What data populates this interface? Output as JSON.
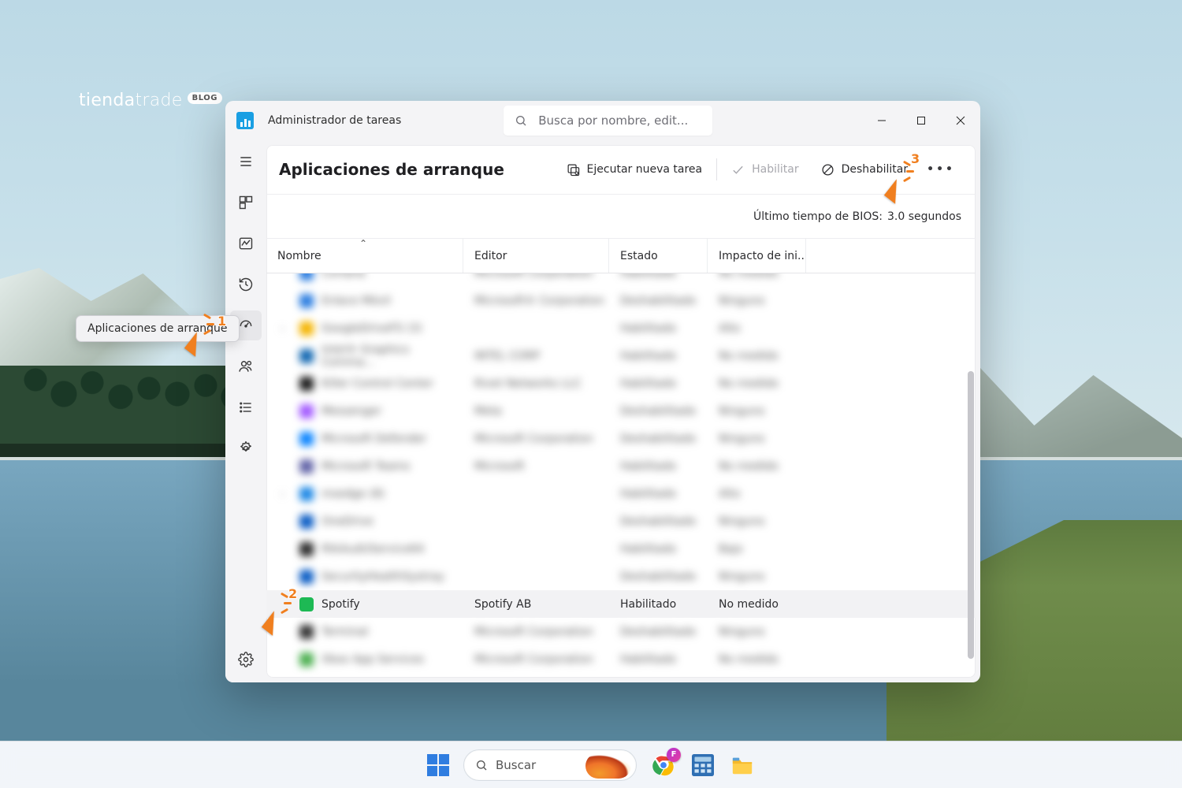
{
  "brand": {
    "part1": "tienda",
    "part2": "trade",
    "pill": "BLOG"
  },
  "taskbar": {
    "search_placeholder": "Buscar",
    "chrome_badge": "F"
  },
  "window": {
    "title": "Administrador de tareas",
    "search_placeholder": "Busca por nombre, edit..."
  },
  "sidebar": {
    "tooltip": "Aplicaciones de arranque",
    "items": [
      {
        "id": "hamburger"
      },
      {
        "id": "processes"
      },
      {
        "id": "performance"
      },
      {
        "id": "history"
      },
      {
        "id": "startup",
        "active": true
      },
      {
        "id": "users"
      },
      {
        "id": "details"
      },
      {
        "id": "services"
      }
    ],
    "bottom": {
      "id": "settings"
    }
  },
  "toolbar": {
    "page_title": "Aplicaciones de arranque",
    "run_new_task": "Ejecutar nueva tarea",
    "enable": "Habilitar",
    "disable": "Deshabilitar"
  },
  "bios": {
    "label": "Último tiempo de BIOS:",
    "value": "3.0 segundos"
  },
  "columns": {
    "name": "Nombre",
    "editor": "Editor",
    "state": "Estado",
    "impact": "Impacto de ini..."
  },
  "rows": [
    {
      "blurred": true,
      "expand": false,
      "icon": "#2b7de0",
      "name": "Cortana",
      "editor": "Microsoft Corporation",
      "state": "Habilitado",
      "impact": "No medido"
    },
    {
      "blurred": true,
      "expand": false,
      "icon": "#2b7de0",
      "name": "Enlace Móvil",
      "editor": "Microsoft® Corporation",
      "state": "Deshabilitado",
      "impact": "Ninguno"
    },
    {
      "blurred": true,
      "expand": true,
      "icon": "#f4b400",
      "name": "GoogleDriveFS (3)",
      "editor": "",
      "state": "Habilitado",
      "impact": "Alto"
    },
    {
      "blurred": true,
      "expand": false,
      "icon": "#1167b1",
      "name": "Intel® Graphics Comma...",
      "editor": "INTEL CORP",
      "state": "Habilitado",
      "impact": "No medido"
    },
    {
      "blurred": true,
      "expand": false,
      "icon": "#1a1a1a",
      "name": "Killer Control Center",
      "editor": "Rivet Networks LLC",
      "state": "Habilitado",
      "impact": "No medido"
    },
    {
      "blurred": true,
      "expand": false,
      "icon": "#a259ff",
      "name": "Messenger",
      "editor": "Meta",
      "state": "Deshabilitado",
      "impact": "Ninguno"
    },
    {
      "blurred": true,
      "expand": false,
      "icon": "#0a84ff",
      "name": "Microsoft Defender",
      "editor": "Microsoft Corporation",
      "state": "Deshabilitado",
      "impact": "Ninguno"
    },
    {
      "blurred": true,
      "expand": false,
      "icon": "#6264a7",
      "name": "Microsoft Teams",
      "editor": "Microsoft",
      "state": "Habilitado",
      "impact": "No medido"
    },
    {
      "blurred": true,
      "expand": true,
      "icon": "#1e88e5",
      "name": "msedge (8)",
      "editor": "",
      "state": "Habilitado",
      "impact": "Alto"
    },
    {
      "blurred": true,
      "expand": false,
      "icon": "#0a5cc4",
      "name": "OneDrive",
      "editor": "",
      "state": "Deshabilitado",
      "impact": "Ninguno"
    },
    {
      "blurred": true,
      "expand": false,
      "icon": "#2b2b2b",
      "name": "RtkAudUService64",
      "editor": "",
      "state": "Habilitado",
      "impact": "Bajo"
    },
    {
      "blurred": true,
      "expand": false,
      "icon": "#0a5cc4",
      "name": "SecurityHealthSystray",
      "editor": "",
      "state": "Deshabilitado",
      "impact": "Ninguno"
    },
    {
      "blurred": false,
      "expand": false,
      "icon": "#1db954",
      "name": "Spotify",
      "editor": "Spotify AB",
      "state": "Habilitado",
      "impact": "No medido",
      "selected": true
    },
    {
      "blurred": true,
      "expand": false,
      "icon": "#333333",
      "name": "Terminal",
      "editor": "Microsoft Corporation",
      "state": "Deshabilitado",
      "impact": "Ninguno"
    },
    {
      "blurred": true,
      "expand": false,
      "icon": "#4caf50",
      "name": "Xbox App Services",
      "editor": "Microsoft Corporation",
      "state": "Habilitado",
      "impact": "No medido"
    }
  ],
  "annotations": {
    "n1": "1",
    "n2": "2",
    "n3": "3"
  }
}
